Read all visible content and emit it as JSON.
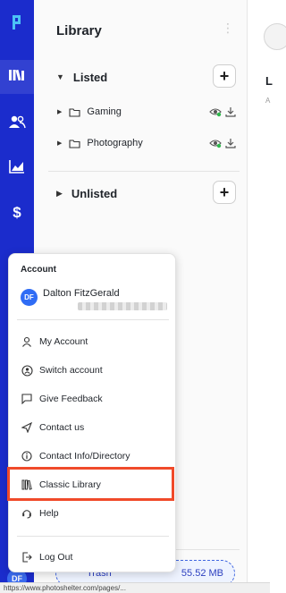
{
  "rail": {
    "nav_items": [
      "logo-icon",
      "library-icon",
      "users-icon",
      "chart-icon",
      "dollar-icon"
    ],
    "avatar_initials": "DF",
    "accent_color": "#1b2ccc"
  },
  "library": {
    "title": "Library",
    "sections": [
      {
        "label": "Listed",
        "folders": [
          {
            "name": "Gaming"
          },
          {
            "name": "Photography"
          }
        ]
      },
      {
        "label": "Unlisted"
      }
    ],
    "storage_size": "55.52 MB",
    "storage_label": "Trash"
  },
  "right_panel": {
    "initial": "L",
    "sub": "A"
  },
  "account_menu": {
    "heading": "Account",
    "avatar_initials": "DF",
    "user_name": "Dalton FitzGerald",
    "items": [
      {
        "label": "My Account",
        "icon": "person-icon"
      },
      {
        "label": "Switch account",
        "icon": "switch-account-icon"
      },
      {
        "label": "Give Feedback",
        "icon": "feedback-icon"
      },
      {
        "label": "Contact us",
        "icon": "send-icon"
      },
      {
        "label": "Contact Info/Directory",
        "icon": "info-icon"
      },
      {
        "label": "Classic Library",
        "icon": "classic-library-icon"
      },
      {
        "label": "Help",
        "icon": "headset-icon"
      },
      {
        "label": "Log Out",
        "icon": "logout-icon"
      }
    ],
    "highlight_color": "#f04a2a"
  },
  "status_url": "https://www.photoshelter.com/pages/..."
}
